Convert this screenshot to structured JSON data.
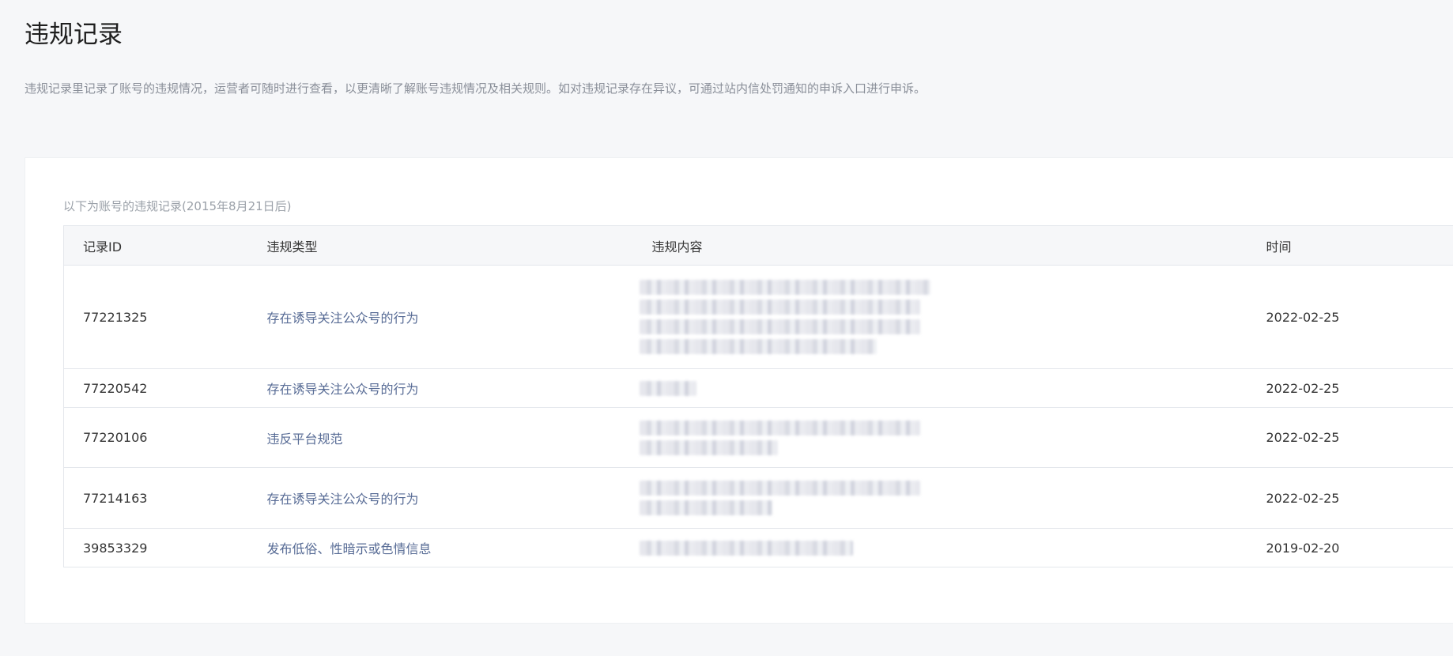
{
  "page": {
    "title": "违规记录",
    "description": "违规记录里记录了账号的违规情况，运营者可随时进行查看，以更清晰了解账号违规情况及相关规则。如对违规记录存在异议，可通过站内信处罚通知的申诉入口进行申诉。"
  },
  "records": {
    "caption": "以下为账号的违规记录(2015年8月21日后)",
    "columns": {
      "id": "记录ID",
      "type": "违规类型",
      "content": "违规内容",
      "time": "时间"
    },
    "rows": [
      {
        "id": "77221325",
        "type": "存在诱导关注公众号的行为",
        "content": "",
        "content_redacted": true,
        "time": "2022-02-25"
      },
      {
        "id": "77220542",
        "type": "存在诱导关注公众号的行为",
        "content": "",
        "content_redacted": true,
        "time": "2022-02-25"
      },
      {
        "id": "77220106",
        "type": "违反平台规范",
        "content": "",
        "content_redacted": true,
        "time": "2022-02-25"
      },
      {
        "id": "77214163",
        "type": "存在诱导关注公众号的行为",
        "content": "",
        "content_redacted": true,
        "time": "2022-02-25"
      },
      {
        "id": "39853329",
        "type": "发布低俗、性暗示或色情信息",
        "content": "",
        "content_redacted": true,
        "time": "2019-02-20"
      }
    ]
  },
  "colors": {
    "link": "#576b95",
    "background": "#f6f7f9",
    "border": "#e4e7ec"
  }
}
